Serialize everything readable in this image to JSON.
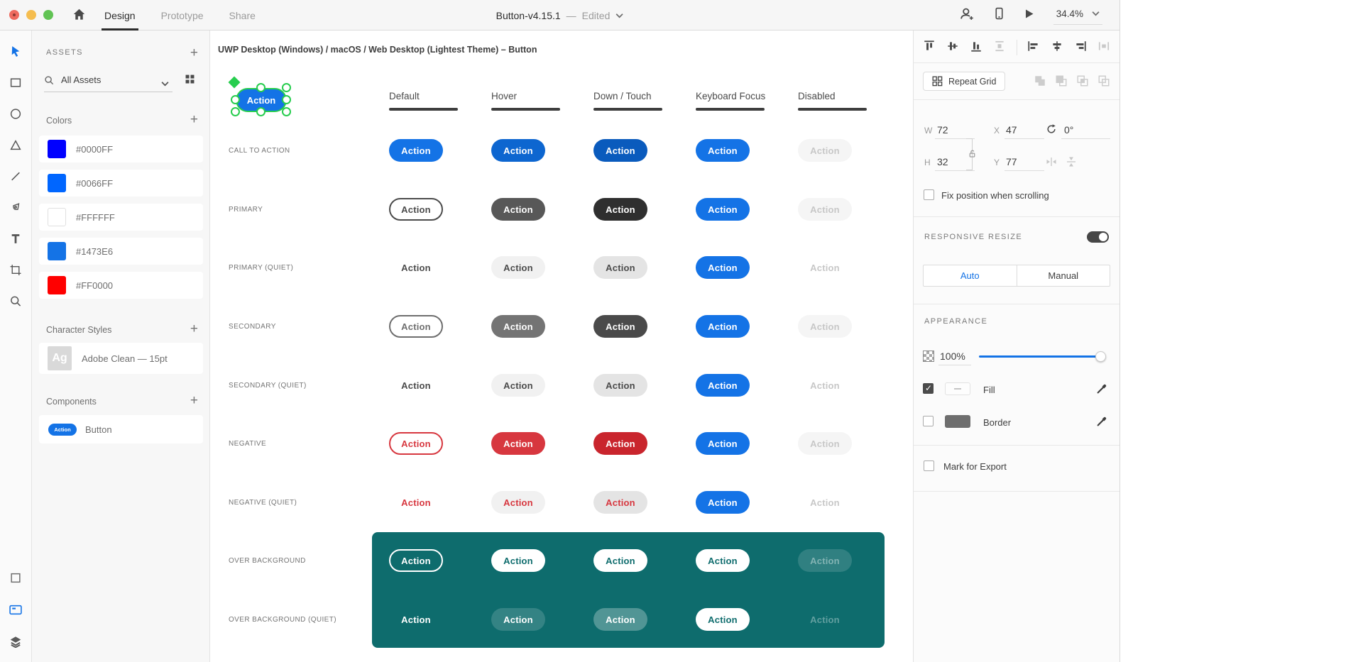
{
  "window": {
    "tabs": [
      {
        "label": "Design",
        "active": true
      },
      {
        "label": "Prototype",
        "active": false
      },
      {
        "label": "Share",
        "active": false
      }
    ],
    "doc_title": "Button-v4.15.1",
    "separator": "—",
    "doc_status": "Edited",
    "zoom_level": "34.4%",
    "titlebar_icons": [
      "close",
      "minimize",
      "zoom-window",
      "home-icon",
      "invite-user-icon",
      "preview-device-icon",
      "play-icon",
      "chevron-down-icon"
    ]
  },
  "toolbar_icons": [
    "select-tool",
    "rectangle-tool",
    "ellipse-tool",
    "polygon-tool",
    "line-tool",
    "pen-tool",
    "text-tool",
    "artboard-tool",
    "zoom-tool",
    "plugins",
    "assets-library",
    "layers"
  ],
  "assets_panel": {
    "title": "ASSETS",
    "add_label": "+",
    "search": {
      "label": "All Assets"
    },
    "colors": {
      "title": "Colors",
      "items": [
        "#0000FF",
        "#0066FF",
        "#FFFFFF",
        "#1473E6",
        "#FF0000"
      ]
    },
    "character_styles": {
      "title": "Character Styles",
      "items": [
        {
          "thumb": "Ag",
          "label": "Adobe Clean — 15pt"
        }
      ]
    },
    "components": {
      "title": "Components",
      "items": [
        {
          "preview": "Action",
          "label": "Button"
        }
      ]
    }
  },
  "canvas": {
    "artboard_title": "UWP Desktop (Windows) / macOS / Web Desktop (Lightest Theme) – Button",
    "selected_component": {
      "label": "Action"
    },
    "button_label": "Action",
    "columns": [
      "Default",
      "Hover",
      "Down / Touch",
      "Keyboard Focus",
      "Disabled"
    ],
    "rows": [
      {
        "label": "CALL TO ACTION",
        "cells": [
          "cta-default",
          "cta-hover",
          "cta-down",
          "focus",
          "disabled"
        ]
      },
      {
        "label": "PRIMARY",
        "cells": [
          "primary-default",
          "primary-hover",
          "primary-down",
          "focus",
          "disabled"
        ]
      },
      {
        "label": "PRIMARY (QUIET)",
        "cells": [
          "quiet-default",
          "quiet-hover",
          "quiet-down",
          "focus",
          "disabled-quiet"
        ]
      },
      {
        "label": "SECONDARY",
        "cells": [
          "secondary-default",
          "secondary-hover",
          "secondary-down",
          "focus",
          "disabled"
        ]
      },
      {
        "label": "SECONDARY (QUIET)",
        "cells": [
          "quiet-default",
          "quiet-hover",
          "quiet-down",
          "focus",
          "disabled-quiet"
        ]
      },
      {
        "label": "NEGATIVE",
        "cells": [
          "negative-default",
          "negative-hover",
          "negative-down",
          "focus",
          "disabled"
        ]
      },
      {
        "label": "NEGATIVE (QUIET)",
        "cells": [
          "negquiet-default",
          "negquiet-hover",
          "negquiet-down",
          "focus",
          "disabled-quiet"
        ]
      },
      {
        "label": "OVER BACKGROUND",
        "cells": [
          "overbg-default",
          "overbg-hover",
          "overbg-down",
          "overbg-focus",
          "overbg-disabled"
        ]
      },
      {
        "label": "OVER BACKGROUND (QUIET)",
        "cells": [
          "obquiet-default",
          "obquiet-hover",
          "obquiet-down",
          "overbg-focus",
          "obquiet-disabled"
        ]
      }
    ]
  },
  "inspector": {
    "align_icons": [
      "align-top",
      "align-middle",
      "align-bottom",
      "distribute-vertical",
      "align-left",
      "align-center",
      "align-right",
      "distribute-horizontal"
    ],
    "repeat_grid_label": "Repeat Grid",
    "boolean_icons": [
      "add",
      "subtract",
      "intersect",
      "exclude-overlap"
    ],
    "transform": {
      "w_label": "W",
      "w": "72",
      "x_label": "X",
      "x": "47",
      "h_label": "H",
      "h": "32",
      "y_label": "Y",
      "y": "77",
      "rotation": "0°"
    },
    "fix_position_label": "Fix position when scrolling",
    "responsive_resize": {
      "title": "RESPONSIVE RESIZE",
      "toggle_on": true,
      "options": [
        {
          "label": "Auto",
          "active": true
        },
        {
          "label": "Manual",
          "active": false
        }
      ]
    },
    "appearance": {
      "title": "APPEARANCE",
      "opacity": "100%",
      "fill_label": "Fill",
      "fill_checked": true,
      "border_label": "Border",
      "border_checked": false
    },
    "mark_for_export_label": "Mark for Export"
  },
  "colors": {
    "accent": "#1473E6",
    "selection_green": "#27CD4E",
    "teal_background": "#0E6C6D",
    "negative_red": "#D7373F",
    "dark": "#4B4B4B"
  }
}
